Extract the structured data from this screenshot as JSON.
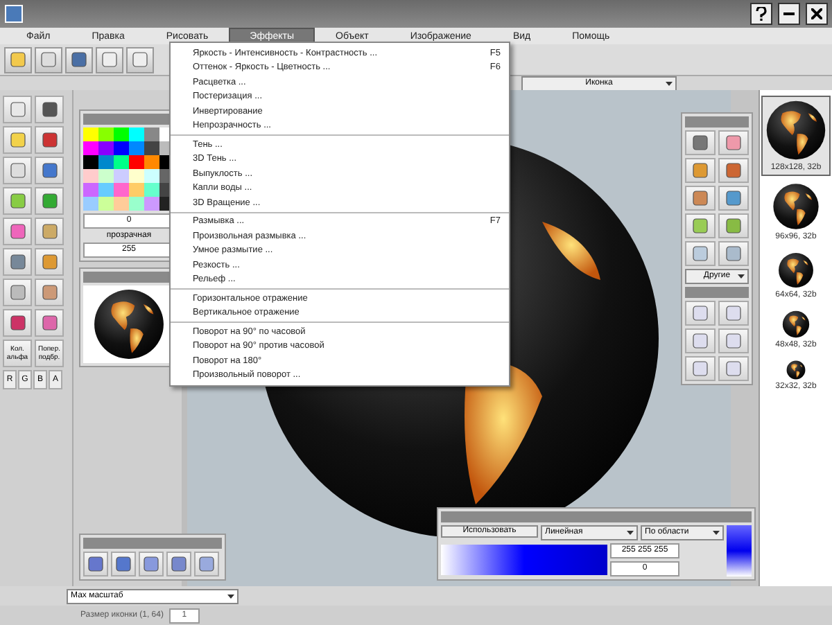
{
  "menu_bar": [
    {
      "label": "Файл",
      "selected": false
    },
    {
      "label": "Правка",
      "selected": false
    },
    {
      "label": "Рисовать",
      "selected": false
    },
    {
      "label": "Эффекты",
      "selected": true
    },
    {
      "label": "Объект",
      "selected": false
    },
    {
      "label": "Изображение",
      "selected": false
    },
    {
      "label": "Вид",
      "selected": false
    },
    {
      "label": "Помощь",
      "selected": false
    }
  ],
  "effects_menu": [
    [
      {
        "label": "Яркость - Интенсивность - Контрастность ...",
        "shortcut": "F5"
      },
      {
        "label": "Оттенок - Яркость - Цветность ...",
        "shortcut": "F6"
      },
      {
        "label": "Расцветка ..."
      },
      {
        "label": "Постеризация ..."
      },
      {
        "label": "Инвертирование"
      },
      {
        "label": "Непрозрачность ..."
      }
    ],
    [
      {
        "label": "Тень ..."
      },
      {
        "label": "3D Тень ..."
      },
      {
        "label": "Выпуклость ..."
      },
      {
        "label": "Капли воды ..."
      },
      {
        "label": "3D Вращение ..."
      }
    ],
    [
      {
        "label": "Размывка ...",
        "shortcut": "F7"
      },
      {
        "label": "Произвольная размывка ..."
      },
      {
        "label": "Умное размытие ..."
      },
      {
        "label": "Резкость ..."
      },
      {
        "label": "Рельеф ..."
      }
    ],
    [
      {
        "label": "Горизонтальное отражение"
      },
      {
        "label": "Вертикальное отражение"
      }
    ],
    [
      {
        "label": "Поворот на 90° по часовой"
      },
      {
        "label": "Поворот на 90° против часовой"
      },
      {
        "label": "Поворот на 180°"
      },
      {
        "label": "Произвольный поворот ..."
      }
    ]
  ],
  "icon_type": "Иконка",
  "tool_text_buttons": [
    "Кол. альфа",
    "Попер. подбр."
  ],
  "channel_buttons": [
    "R",
    "G",
    "B",
    "A"
  ],
  "color_panel": {
    "label": "прозрачная",
    "fields": [
      "0",
      "255"
    ]
  },
  "effects_panel": {
    "dropdown": "Другие"
  },
  "thumbnails": [
    {
      "label": "128x128, 32b",
      "selected": true
    },
    {
      "label": "96x96, 32b",
      "selected": false
    },
    {
      "label": "64x64, 32b",
      "selected": false
    },
    {
      "label": "48x48, 32b",
      "selected": false
    },
    {
      "label": "32x32, 32b",
      "selected": false
    }
  ],
  "gradient_panel": {
    "button": "Использовать",
    "type": "Линейная",
    "mode": "По области",
    "rgb": "255 255 255",
    "value": "0"
  },
  "zoom_select": "Мах масштаб",
  "status": {
    "label": "Размер иконки (1, 64)",
    "field": "1"
  }
}
